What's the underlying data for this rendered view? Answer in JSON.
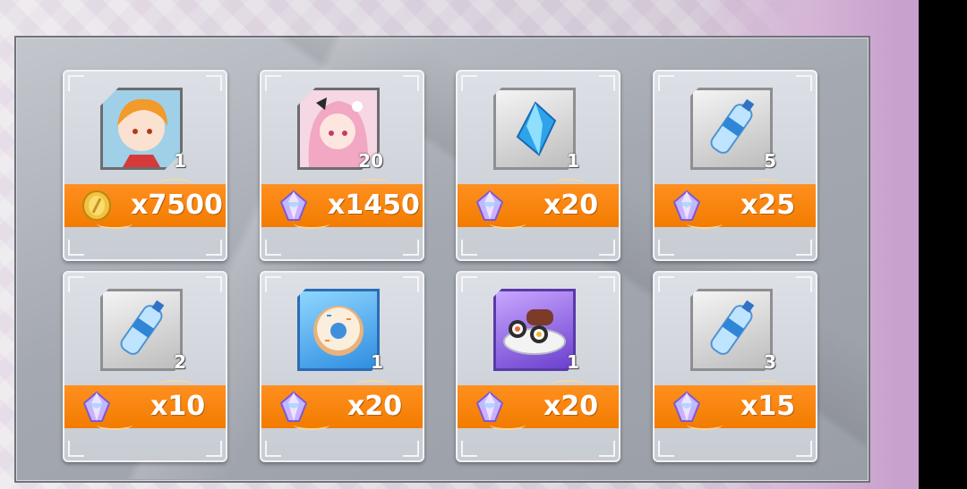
{
  "shop": {
    "items": [
      {
        "name": "character-shard-orange-hair",
        "qty": "1",
        "currency": "gold-coin-icon",
        "price": "x7500",
        "kind": "hex",
        "art": "orange-hair-portrait"
      },
      {
        "name": "character-shard-pink-hair",
        "qty": "20",
        "currency": "crystal-icon",
        "price": "x1450",
        "kind": "hex",
        "art": "pink-hair-portrait"
      },
      {
        "name": "blue-crystal-item",
        "qty": "1",
        "currency": "crystal-icon",
        "price": "x20",
        "kind": "plain",
        "art": "blue-crystal-icon"
      },
      {
        "name": "water-bottle-item",
        "qty": "5",
        "currency": "crystal-icon",
        "price": "x25",
        "kind": "plain",
        "art": "water-bottle-icon"
      },
      {
        "name": "water-bottle-item",
        "qty": "2",
        "currency": "crystal-icon",
        "price": "x10",
        "kind": "plain",
        "art": "water-bottle-icon"
      },
      {
        "name": "donut-item",
        "qty": "1",
        "currency": "crystal-icon",
        "price": "x20",
        "kind": "blue",
        "art": "donut-icon"
      },
      {
        "name": "sushi-roll-item",
        "qty": "1",
        "currency": "crystal-icon",
        "price": "x20",
        "kind": "purple",
        "art": "sushi-plate-icon"
      },
      {
        "name": "water-bottle-item",
        "qty": "3",
        "currency": "crystal-icon",
        "price": "x15",
        "kind": "plain",
        "art": "water-bottle-icon"
      }
    ]
  },
  "colors": {
    "price_bar": "#f27c00",
    "card": "#cfd3da",
    "panel": "#a4a8b0"
  }
}
